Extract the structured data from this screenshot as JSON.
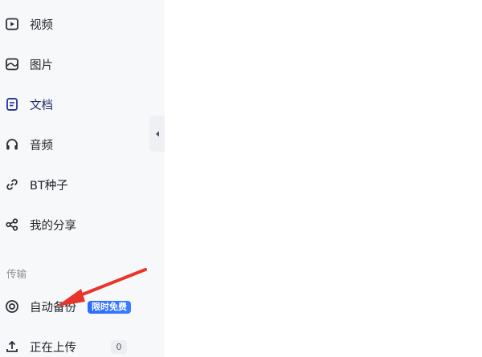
{
  "sidebar": {
    "items": [
      {
        "label": "视频",
        "icon": "video-icon"
      },
      {
        "label": "图片",
        "icon": "image-icon"
      },
      {
        "label": "文档",
        "icon": "document-icon"
      },
      {
        "label": "音频",
        "icon": "headphones-icon"
      },
      {
        "label": "BT种子",
        "icon": "link-icon"
      },
      {
        "label": "我的分享",
        "icon": "share-icon"
      }
    ],
    "transfer_section_label": "传输",
    "transfer_items": [
      {
        "label": "自动备份",
        "icon": "backup-icon",
        "badge": "限时免费"
      },
      {
        "label": "正在上传",
        "icon": "upload-icon",
        "count": "0"
      }
    ]
  },
  "colors": {
    "active_icon": "#2f3b9a",
    "badge": "#2d6bff",
    "annotation_arrow": "#e8352b"
  }
}
